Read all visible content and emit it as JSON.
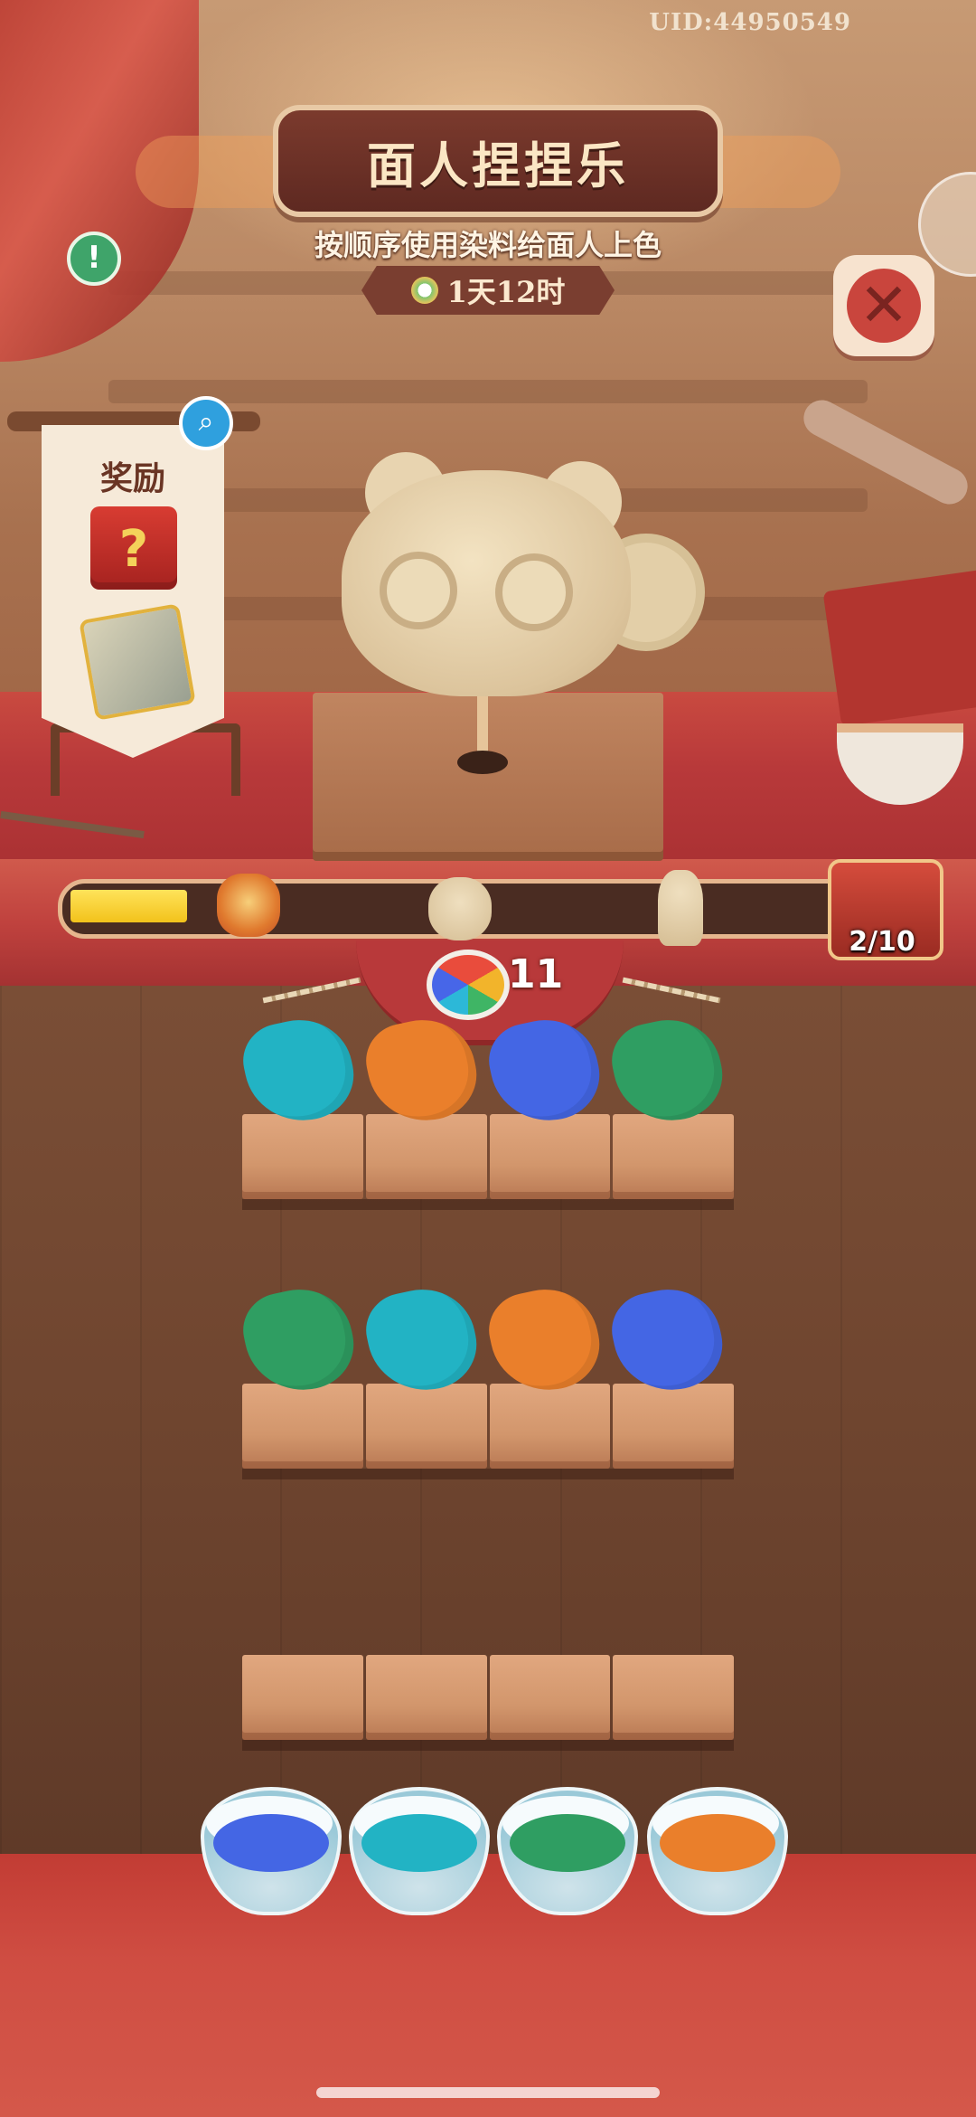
{
  "header": {
    "uid": "UID:44950549",
    "title": "面人捏捏乐",
    "subtitle": "按顺序使用染料给面人上色",
    "timer": "1天12时"
  },
  "rewards": {
    "title": "奖励"
  },
  "progress": {
    "fraction": 0.15,
    "label": "2/10"
  },
  "dye_count": "11",
  "colors": {
    "teal": "#22b3c4",
    "orange": "#ea7f2b",
    "blue": "#4466e4",
    "green": "#2f9e62"
  },
  "shelves": [
    {
      "slots": [
        "teal",
        "orange",
        "blue",
        "green"
      ]
    },
    {
      "slots": [
        "green",
        "teal",
        "orange",
        "blue"
      ]
    },
    {
      "slots": []
    }
  ],
  "paint_bowls": [
    "blue",
    "teal",
    "green",
    "orange"
  ],
  "icons": {
    "alert": "exclamation-icon",
    "close": "close-icon",
    "zoom": "magnifier-icon",
    "gift": "mystery-gift-icon",
    "tickets": "ticket-bundle-icon",
    "chest": "treasure-chest-icon"
  }
}
